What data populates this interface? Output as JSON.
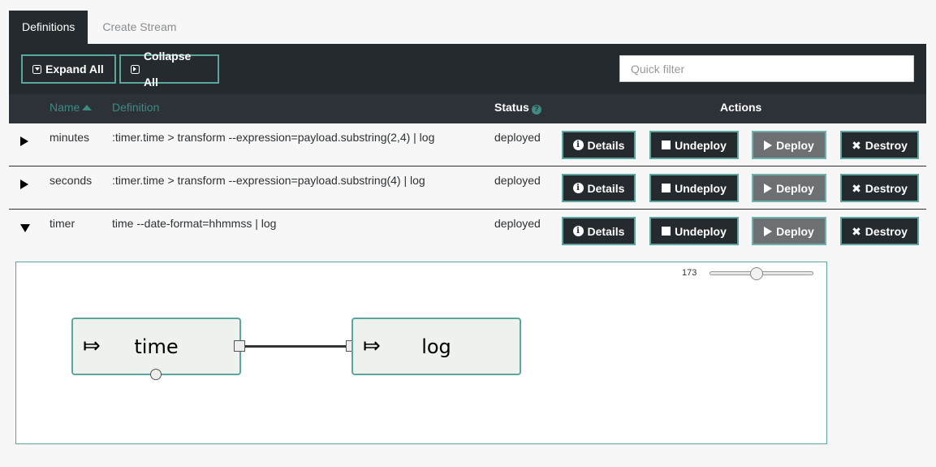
{
  "tabs": [
    {
      "label": "Definitions",
      "active": true
    },
    {
      "label": "Create Stream",
      "active": false
    }
  ],
  "toolbar": {
    "expand_all_label": "Expand All",
    "collapse_all_label": "Collapse All",
    "filter_placeholder": "Quick filter",
    "filter_value": ""
  },
  "table": {
    "columns": {
      "name": "Name",
      "definition": "Definition",
      "status": "Status",
      "actions": "Actions"
    },
    "sort": {
      "column": "name",
      "direction": "ascending"
    },
    "rows": [
      {
        "expanded": false,
        "name": "minutes",
        "definition": ":timer.time > transform --expression=payload.substring(2,4) | log",
        "status": "deployed",
        "actions": {
          "details": "Details",
          "undeploy": "Undeploy",
          "deploy": "Deploy",
          "destroy": "Destroy"
        }
      },
      {
        "expanded": false,
        "name": "seconds",
        "definition": ":timer.time > transform --expression=payload.substring(4) | log",
        "status": "deployed",
        "actions": {
          "details": "Details",
          "undeploy": "Undeploy",
          "deploy": "Deploy",
          "destroy": "Destroy"
        }
      },
      {
        "expanded": true,
        "name": "timer",
        "definition": "time --date-format=hhmmss | log",
        "status": "deployed",
        "actions": {
          "details": "Details",
          "undeploy": "Undeploy",
          "deploy": "Deploy",
          "destroy": "Destroy"
        }
      }
    ]
  },
  "graph": {
    "zoom_value": "173",
    "zoom_fraction": 0.45,
    "nodes": [
      {
        "id": "time",
        "label": "time",
        "icon": "source-arrow-icon",
        "icon_glyph": "⤇"
      },
      {
        "id": "log",
        "label": "log",
        "icon": "sink-arrow-icon",
        "icon_glyph": "⤇"
      }
    ],
    "links": [
      {
        "from": "time",
        "to": "log"
      }
    ]
  },
  "colors": {
    "dark": "#242a2e",
    "header": "#2c3238",
    "accent": "#5ba69e",
    "accent_text": "#3e8a80",
    "deploy_disabled": "#6c7073",
    "node_fill": "#eef2ee"
  }
}
